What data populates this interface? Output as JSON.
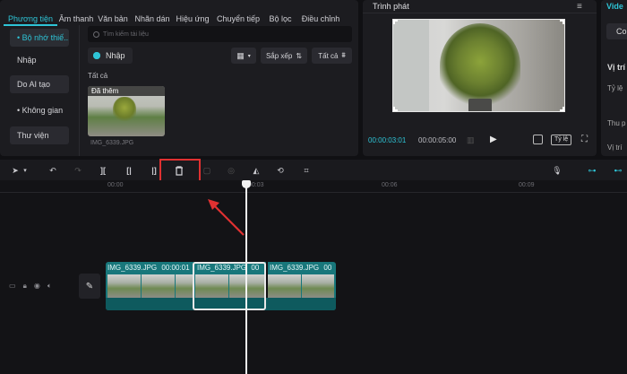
{
  "top_tabs": [
    {
      "label": "Phương tiện",
      "active": true
    },
    {
      "label": "Âm thanh"
    },
    {
      "label": "Văn bản"
    },
    {
      "label": "Nhãn dán"
    },
    {
      "label": "Hiệu ứng"
    },
    {
      "label": "Chuyển tiếp"
    },
    {
      "label": "Bộ lọc"
    },
    {
      "label": "Điều chỉnh"
    }
  ],
  "sidebar": {
    "items": [
      {
        "label": "• Bộ nhớ thiế...",
        "active": true
      },
      {
        "label": "Nhập"
      },
      {
        "label": "Do AI tạo"
      },
      {
        "label": "• Không gian"
      },
      {
        "label": "Thư viện"
      }
    ]
  },
  "media": {
    "search_placeholder": "Tìm kiếm tài liệu",
    "import_label": "Nhập",
    "sort_label": "Sắp xếp",
    "filter_label": "Tất cả",
    "section_label": "Tất cả",
    "thumb_badge": "Đã thêm",
    "filename": "IMG_6339.JPG"
  },
  "player": {
    "title": "Trình phát",
    "current_time": "00:00:03:01",
    "total_time": "00:00:05:00",
    "ratio_label": "Tỷ lệ"
  },
  "inspector": {
    "header": "Vide",
    "tab": "Co",
    "items": [
      "Vị trí",
      "Tỷ lệ",
      "Thu p",
      "Vị trí"
    ]
  },
  "timeline": {
    "ruler": [
      "00:00",
      "00:03",
      "00:06",
      "00:09"
    ],
    "clips": [
      {
        "label": "IMG_6339.JPG"
      },
      {
        "label": "IMG_6339.JPG"
      },
      {
        "label": "IMG_6339.JPG"
      }
    ],
    "clip_overflow": [
      "00:00:01",
      "00",
      "00"
    ]
  },
  "colors": {
    "accent": "#2ec4d6",
    "highlight": "#e03131",
    "track": "#1a6a6e"
  }
}
